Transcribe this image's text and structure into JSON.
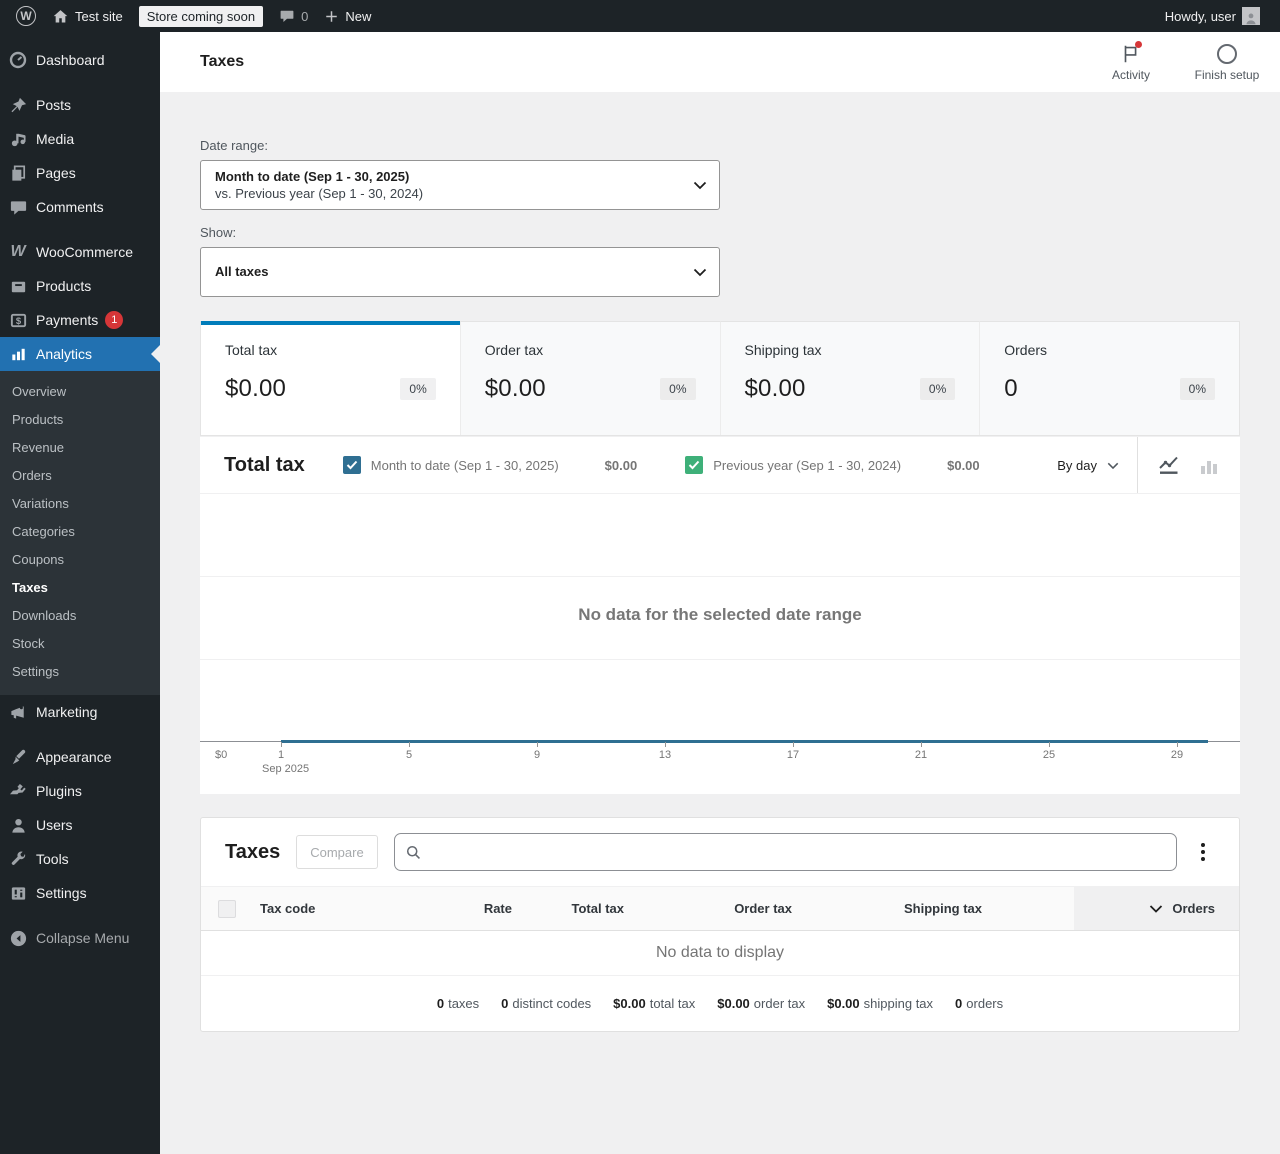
{
  "colors": {
    "accent_blue": "#2271b1",
    "selected_tab_bar": "#007cba",
    "series_1": "#2f6f92",
    "series_2": "#3eb079",
    "badge_red": "#d63638"
  },
  "admin_bar": {
    "site_name": "Test site",
    "store_badge": "Store coming soon",
    "comments_count": "0",
    "new_label": "New",
    "howdy": "Howdy, user"
  },
  "sidebar": {
    "items": [
      {
        "label": "Dashboard",
        "icon": "dashboard-icon"
      },
      {
        "label": "Posts",
        "icon": "pin-icon"
      },
      {
        "label": "Media",
        "icon": "media-icon"
      },
      {
        "label": "Pages",
        "icon": "pages-icon"
      },
      {
        "label": "Comments",
        "icon": "comment-icon"
      },
      {
        "label": "WooCommerce",
        "icon": "woocommerce-icon"
      },
      {
        "label": "Products",
        "icon": "products-icon"
      },
      {
        "label": "Payments",
        "icon": "payments-icon",
        "badge": "1"
      },
      {
        "label": "Analytics",
        "icon": "analytics-icon",
        "active": true
      },
      {
        "label": "Marketing",
        "icon": "megaphone-icon"
      },
      {
        "label": "Appearance",
        "icon": "brush-icon"
      },
      {
        "label": "Plugins",
        "icon": "plugin-icon"
      },
      {
        "label": "Users",
        "icon": "user-icon"
      },
      {
        "label": "Tools",
        "icon": "wrench-icon"
      },
      {
        "label": "Settings",
        "icon": "sliders-icon"
      }
    ],
    "submenu": [
      {
        "label": "Overview"
      },
      {
        "label": "Products"
      },
      {
        "label": "Revenue"
      },
      {
        "label": "Orders"
      },
      {
        "label": "Variations"
      },
      {
        "label": "Categories"
      },
      {
        "label": "Coupons"
      },
      {
        "label": "Taxes",
        "current": true
      },
      {
        "label": "Downloads"
      },
      {
        "label": "Stock"
      },
      {
        "label": "Settings"
      }
    ],
    "collapse_label": "Collapse Menu"
  },
  "header": {
    "title": "Taxes",
    "activity_label": "Activity",
    "finish_setup_label": "Finish setup"
  },
  "filters": {
    "date_range_label": "Date range:",
    "date_range_primary": "Month to date (Sep 1 - 30, 2025)",
    "date_range_secondary": "vs. Previous year (Sep 1 - 30, 2024)",
    "show_label": "Show:",
    "show_value": "All taxes"
  },
  "stats": {
    "tiles": [
      {
        "label": "Total tax",
        "value": "$0.00",
        "delta": "0%",
        "selected": true
      },
      {
        "label": "Order tax",
        "value": "$0.00",
        "delta": "0%"
      },
      {
        "label": "Shipping tax",
        "value": "$0.00",
        "delta": "0%"
      },
      {
        "label": "Orders",
        "value": "0",
        "delta": "0%"
      }
    ]
  },
  "chart_data": {
    "type": "line",
    "title": "Total tax",
    "interval": "By day",
    "empty_message": "No data for the selected date range",
    "x_label_month": "Sep 2025",
    "x_ticks": [
      "1",
      "5",
      "9",
      "13",
      "17",
      "21",
      "25",
      "29"
    ],
    "y_zero_label": "$0",
    "ylim": [
      0,
      1
    ],
    "grid": true,
    "legend_position": "top",
    "series": [
      {
        "name": "Month to date (Sep 1 - 30, 2025)",
        "total": "$0.00",
        "color": "#2f6f92",
        "x": [
          1,
          2,
          3,
          4,
          5,
          6,
          7,
          8,
          9,
          10,
          11,
          12,
          13,
          14,
          15,
          16,
          17,
          18,
          19,
          20,
          21,
          22,
          23,
          24,
          25,
          26,
          27,
          28,
          29,
          30
        ],
        "values": [
          0,
          0,
          0,
          0,
          0,
          0,
          0,
          0,
          0,
          0,
          0,
          0,
          0,
          0,
          0,
          0,
          0,
          0,
          0,
          0,
          0,
          0,
          0,
          0,
          0,
          0,
          0,
          0,
          0,
          0
        ]
      },
      {
        "name": "Previous year (Sep 1 - 30, 2024)",
        "total": "$0.00",
        "color": "#3eb079",
        "x": [
          1,
          2,
          3,
          4,
          5,
          6,
          7,
          8,
          9,
          10,
          11,
          12,
          13,
          14,
          15,
          16,
          17,
          18,
          19,
          20,
          21,
          22,
          23,
          24,
          25,
          26,
          27,
          28,
          29,
          30
        ],
        "values": [
          0,
          0,
          0,
          0,
          0,
          0,
          0,
          0,
          0,
          0,
          0,
          0,
          0,
          0,
          0,
          0,
          0,
          0,
          0,
          0,
          0,
          0,
          0,
          0,
          0,
          0,
          0,
          0,
          0,
          0
        ]
      }
    ]
  },
  "table": {
    "title": "Taxes",
    "compare_label": "Compare",
    "search_placeholder": "",
    "search_value": "",
    "columns": [
      {
        "label": "Tax code"
      },
      {
        "label": "Rate"
      },
      {
        "label": "Total tax"
      },
      {
        "label": "Order tax"
      },
      {
        "label": "Shipping tax"
      },
      {
        "label": "Orders",
        "sorted": "desc"
      }
    ],
    "rows": [],
    "empty_message": "No data to display",
    "summary": [
      {
        "value": "0",
        "label": "taxes"
      },
      {
        "value": "0",
        "label": "distinct codes"
      },
      {
        "value": "$0.00",
        "label": "total tax"
      },
      {
        "value": "$0.00",
        "label": "order tax"
      },
      {
        "value": "$0.00",
        "label": "shipping tax"
      },
      {
        "value": "0",
        "label": "orders"
      }
    ]
  }
}
